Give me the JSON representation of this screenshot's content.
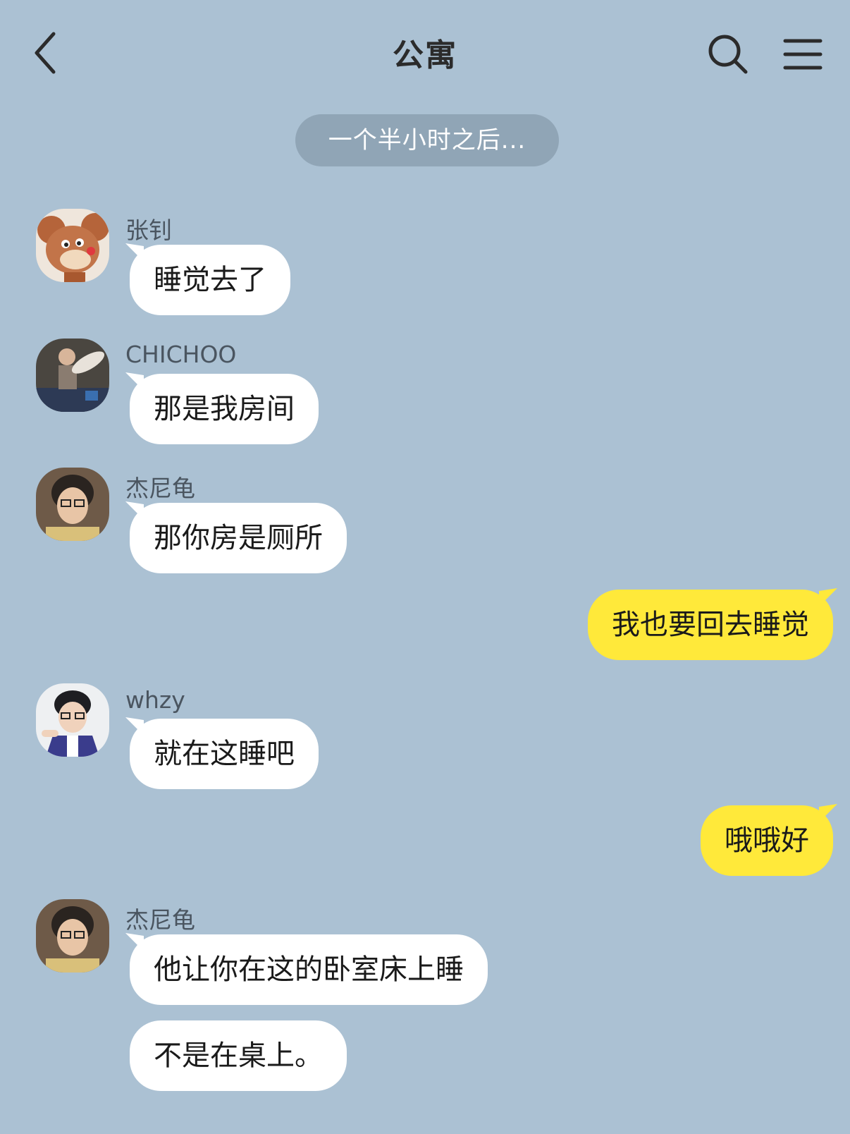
{
  "header": {
    "title": "公寓"
  },
  "time_divider": "一个半小时之后...",
  "messages": [
    {
      "sender": "张钊",
      "text": "睡觉去了"
    },
    {
      "sender": "CHICHOO",
      "text": "那是我房间"
    },
    {
      "sender": "杰尼龟",
      "text": "那你房是厕所"
    },
    {
      "text": "我也要回去睡觉"
    },
    {
      "sender": "whzy",
      "text": "就在这睡吧"
    },
    {
      "text": "哦哦好"
    },
    {
      "sender": "杰尼龟",
      "text": "他让你在这的卧室床上睡"
    },
    {
      "text": "不是在桌上。"
    }
  ],
  "colors": {
    "background": "#abc1d3",
    "incoming_bubble": "#ffffff",
    "outgoing_bubble": "#ffe93a",
    "divider_pill": "#90a5b6"
  }
}
